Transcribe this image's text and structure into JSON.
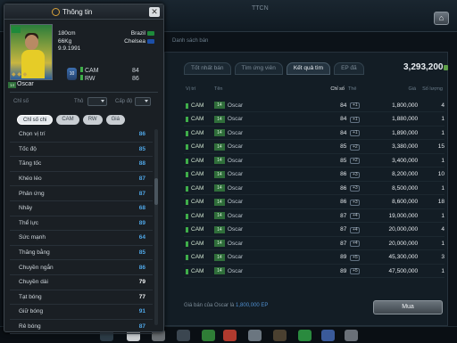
{
  "window": {
    "title": "TTCN",
    "subtitle": "Danh sách bán"
  },
  "market": {
    "tabs": [
      {
        "label": "Tốt nhất bán",
        "active": false
      },
      {
        "label": "Tìm ứng viên",
        "active": false
      },
      {
        "label": "Kết quả tìm",
        "active": true
      },
      {
        "label": "EP đã",
        "active": false
      }
    ],
    "balance": "3,293,200",
    "columns": [
      "Vị trí",
      "Tên",
      "Chỉ số",
      "Thẻ",
      "Giá",
      "Số lượng"
    ],
    "rows": [
      {
        "pos": "CAM",
        "badge": "14",
        "name": "Oscar",
        "ovr": "84",
        "lvl": "+1",
        "price": "1,800,000",
        "qty": "4"
      },
      {
        "pos": "CAM",
        "badge": "14",
        "name": "Oscar",
        "ovr": "84",
        "lvl": "+1",
        "price": "1,880,000",
        "qty": "1"
      },
      {
        "pos": "CAM",
        "badge": "14",
        "name": "Oscar",
        "ovr": "84",
        "lvl": "+1",
        "price": "1,890,000",
        "qty": "1"
      },
      {
        "pos": "CAM",
        "badge": "14",
        "name": "Oscar",
        "ovr": "85",
        "lvl": "+2",
        "price": "3,380,000",
        "qty": "15"
      },
      {
        "pos": "CAM",
        "badge": "14",
        "name": "Oscar",
        "ovr": "85",
        "lvl": "+2",
        "price": "3,400,000",
        "qty": "1"
      },
      {
        "pos": "CAM",
        "badge": "14",
        "name": "Oscar",
        "ovr": "86",
        "lvl": "+3",
        "price": "8,200,000",
        "qty": "10"
      },
      {
        "pos": "CAM",
        "badge": "14",
        "name": "Oscar",
        "ovr": "86",
        "lvl": "+3",
        "price": "8,500,000",
        "qty": "1"
      },
      {
        "pos": "CAM",
        "badge": "14",
        "name": "Oscar",
        "ovr": "86",
        "lvl": "+3",
        "price": "8,600,000",
        "qty": "18"
      },
      {
        "pos": "CAM",
        "badge": "14",
        "name": "Oscar",
        "ovr": "87",
        "lvl": "+4",
        "price": "19,000,000",
        "qty": "1"
      },
      {
        "pos": "CAM",
        "badge": "14",
        "name": "Oscar",
        "ovr": "87",
        "lvl": "+4",
        "price": "20,000,000",
        "qty": "4"
      },
      {
        "pos": "CAM",
        "badge": "14",
        "name": "Oscar",
        "ovr": "87",
        "lvl": "+4",
        "price": "20,000,000",
        "qty": "1"
      },
      {
        "pos": "CAM",
        "badge": "14",
        "name": "Oscar",
        "ovr": "89",
        "lvl": "+5",
        "price": "45,300,000",
        "qty": "3"
      },
      {
        "pos": "CAM",
        "badge": "14",
        "name": "Oscar",
        "ovr": "89",
        "lvl": "+5",
        "price": "47,500,000",
        "qty": "1"
      }
    ],
    "footer_text": "Giá bán của Oscar là",
    "footer_price": "1,800,000 EP",
    "buy_label": "Mua"
  },
  "panel": {
    "title": "Thông tin",
    "close_label": "✕",
    "player": {
      "badge": "14",
      "name": "Oscar",
      "height": "180cm",
      "weight": "66Kg",
      "dob": "9.9.1991",
      "nation": "Brazil",
      "club": "Chelsea",
      "shirt": "10",
      "positions": [
        {
          "pos": "CAM",
          "val": "84"
        },
        {
          "pos": "RW",
          "val": "86"
        }
      ]
    },
    "filter": {
      "label": "Chỉ số",
      "tho_label": "Thô",
      "level_label": "Cấp độ"
    },
    "sub_tabs": [
      {
        "label": "Chỉ số chi",
        "active": true
      },
      {
        "label": "CAM",
        "active": false
      },
      {
        "label": "RW",
        "active": false
      },
      {
        "label": "Giá",
        "active": false
      }
    ],
    "attributes": [
      {
        "name": "Chọn vị trí",
        "value": "86",
        "color": "blue"
      },
      {
        "name": "Tốc độ",
        "value": "85",
        "color": "blue"
      },
      {
        "name": "Tăng tốc",
        "value": "88",
        "color": "blue"
      },
      {
        "name": "Khéo léo",
        "value": "87",
        "color": "blue"
      },
      {
        "name": "Phản ứng",
        "value": "87",
        "color": "blue"
      },
      {
        "name": "Nhảy",
        "value": "68",
        "color": "blue"
      },
      {
        "name": "Thể lực",
        "value": "89",
        "color": "blue"
      },
      {
        "name": "Sức mạnh",
        "value": "64",
        "color": "blue"
      },
      {
        "name": "Thăng bằng",
        "value": "85",
        "color": "blue"
      },
      {
        "name": "Chuyền ngắn",
        "value": "86",
        "color": "blue"
      },
      {
        "name": "Chuyền dài",
        "value": "79",
        "color": "white"
      },
      {
        "name": "Tạt bóng",
        "value": "77",
        "color": "white"
      },
      {
        "name": "Giữ bóng",
        "value": "91",
        "color": "blue"
      },
      {
        "name": "Rê bóng",
        "value": "87",
        "color": "blue"
      }
    ]
  },
  "colors": {
    "accent_blue": "#4fa6e6",
    "position_green": "#3fae4a"
  }
}
